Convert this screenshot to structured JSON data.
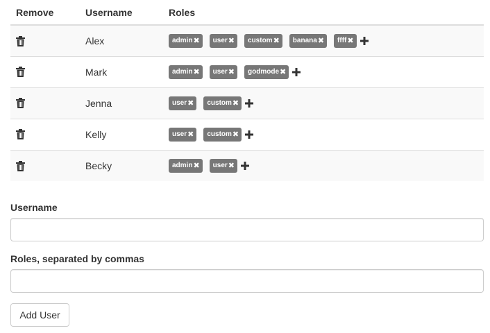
{
  "table": {
    "headers": {
      "remove": "Remove",
      "username": "Username",
      "roles": "Roles"
    },
    "rows": [
      {
        "username": "Alex",
        "roles": [
          "admin",
          "user",
          "custom",
          "banana",
          "ffff"
        ]
      },
      {
        "username": "Mark",
        "roles": [
          "admin",
          "user",
          "godmode"
        ]
      },
      {
        "username": "Jenna",
        "roles": [
          "user",
          "custom"
        ]
      },
      {
        "username": "Kelly",
        "roles": [
          "user",
          "custom"
        ]
      },
      {
        "username": "Becky",
        "roles": [
          "admin",
          "user"
        ]
      }
    ],
    "remove_icon": "trash-icon",
    "role_remove_glyph": "✖",
    "add_role_icon": "plus-icon"
  },
  "form": {
    "username_label": "Username",
    "username_value": "",
    "roles_label": "Roles, separated by commas",
    "roles_value": "",
    "add_button_label": "Add User"
  },
  "colors": {
    "badge_bg": "#777777",
    "stripe_bg": "#f9f9f9",
    "border": "#dddddd"
  }
}
